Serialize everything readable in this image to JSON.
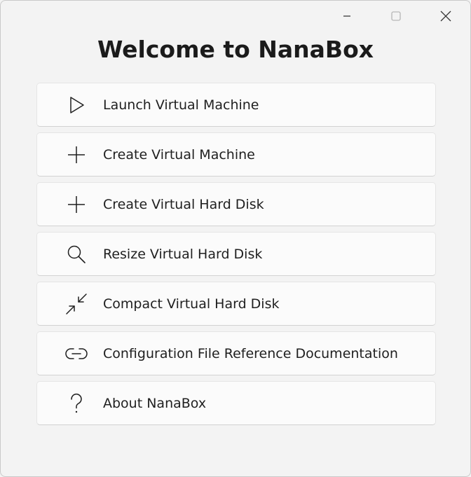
{
  "window": {
    "controls": {
      "minimize": "minimize-icon",
      "maximize": "maximize-icon",
      "close": "close-icon"
    }
  },
  "header": {
    "title": "Welcome to NanaBox"
  },
  "menu": {
    "items": [
      {
        "label": "Launch Virtual Machine",
        "icon": "play-icon"
      },
      {
        "label": "Create Virtual Machine",
        "icon": "plus-icon"
      },
      {
        "label": "Create Virtual Hard Disk",
        "icon": "plus-icon"
      },
      {
        "label": "Resize Virtual Hard Disk",
        "icon": "search-icon"
      },
      {
        "label": "Compact Virtual Hard Disk",
        "icon": "compact-arrows-icon"
      },
      {
        "label": "Configuration File Reference Documentation",
        "icon": "link-icon"
      },
      {
        "label": "About NanaBox",
        "icon": "question-mark-icon"
      }
    ]
  },
  "colors": {
    "background": "#f3f3f3",
    "card": "#fbfbfb",
    "text": "#1b1b1b"
  }
}
